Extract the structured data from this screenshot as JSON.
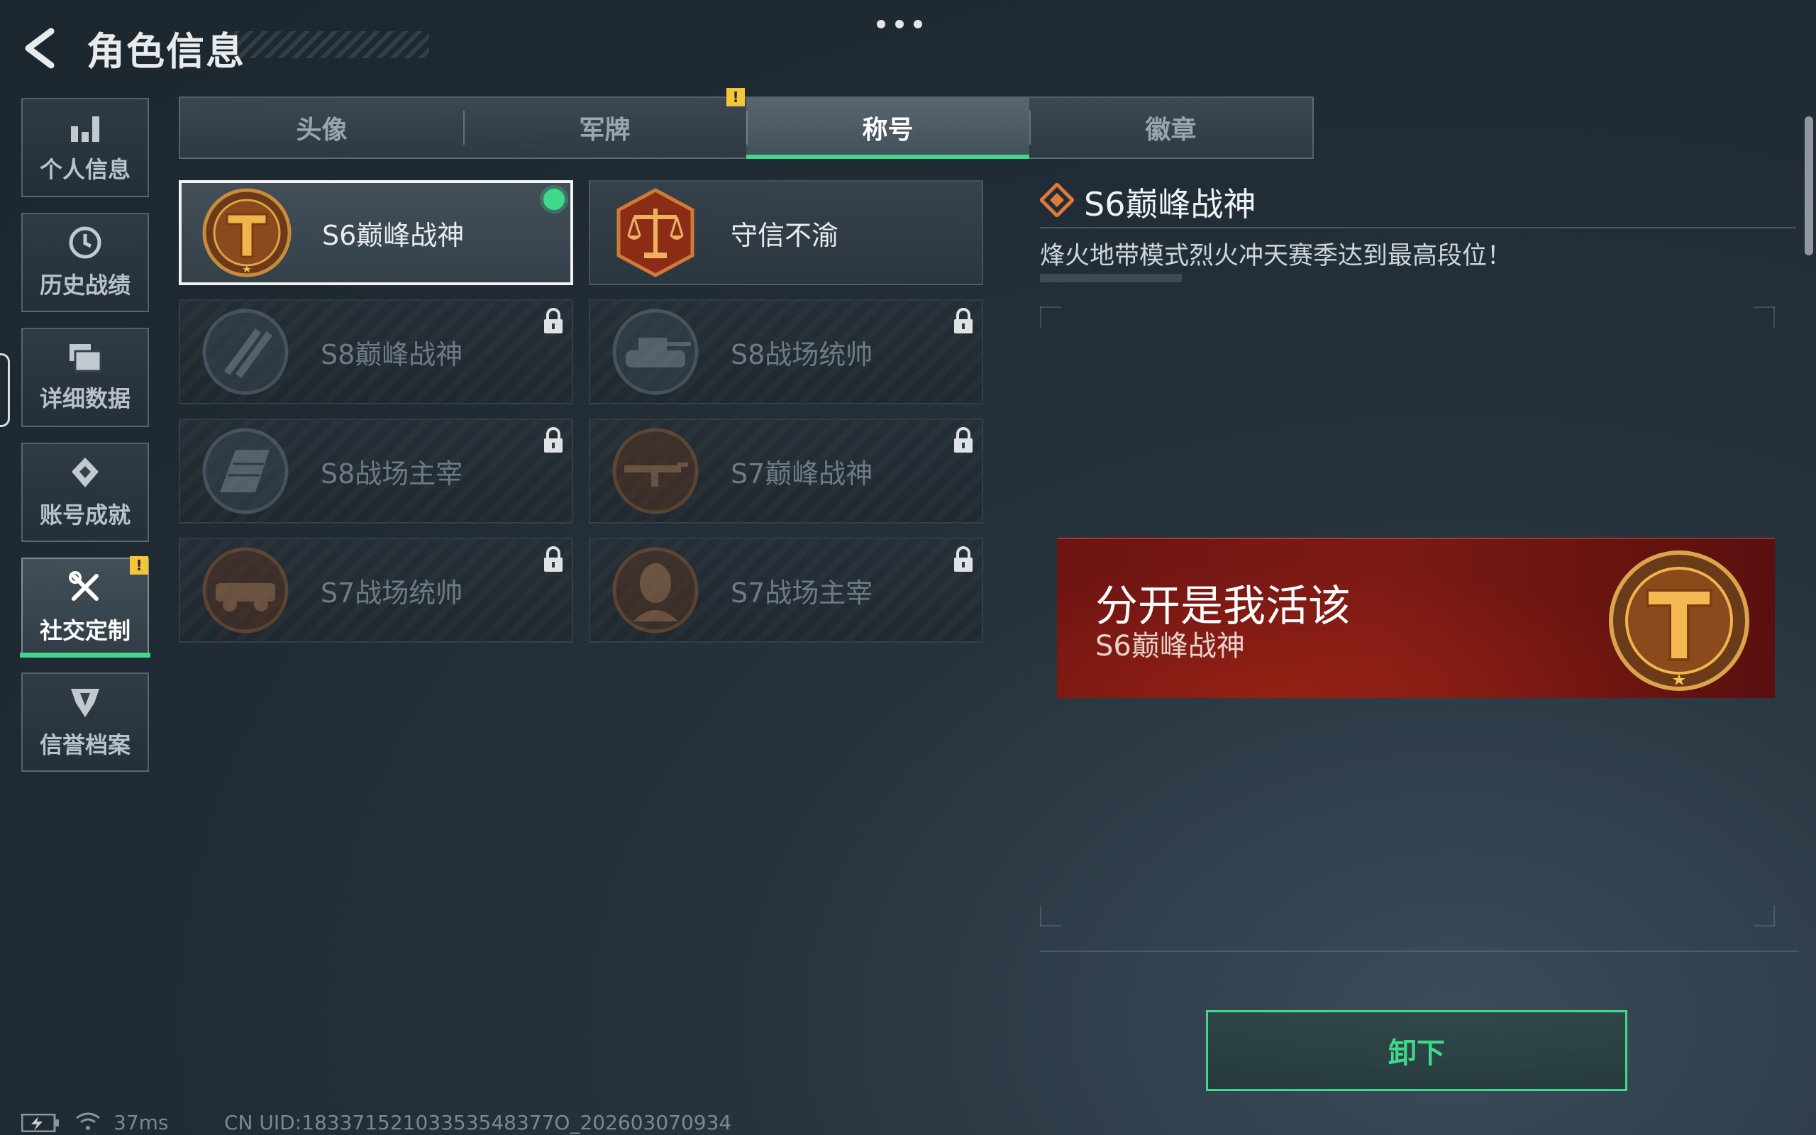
{
  "header": {
    "title": "角色信息"
  },
  "sidebar": {
    "items": [
      {
        "label": "个人信息",
        "icon": "bar-chart-icon"
      },
      {
        "label": "历史战绩",
        "icon": "history-clock-icon"
      },
      {
        "label": "详细数据",
        "icon": "folder-icon"
      },
      {
        "label": "账号成就",
        "icon": "achievement-icon"
      },
      {
        "label": "社交定制",
        "icon": "tools-icon",
        "active": true,
        "badge": "!"
      },
      {
        "label": "信誉档案",
        "icon": "credit-shield-icon"
      }
    ]
  },
  "tabs": [
    {
      "label": "头像"
    },
    {
      "label": "军牌",
      "badge": "!"
    },
    {
      "label": "称号",
      "active": true
    },
    {
      "label": "徽章"
    }
  ],
  "titles": [
    {
      "name": "S6巅峰战神",
      "selected": true,
      "locked": false,
      "icon": "golden-t-emblem-icon"
    },
    {
      "name": "守信不渝",
      "selected": false,
      "locked": false,
      "icon": "scales-emblem-icon"
    },
    {
      "name": "S8巅峰战神",
      "selected": false,
      "locked": true,
      "icon": "slash-emblem-icon"
    },
    {
      "name": "S8战场统帅",
      "selected": false,
      "locked": true,
      "icon": "tank-emblem-icon"
    },
    {
      "name": "S8战场主宰",
      "selected": false,
      "locked": true,
      "icon": "building-emblem-icon"
    },
    {
      "name": "S7巅峰战神",
      "selected": false,
      "locked": true,
      "icon": "rifle-emblem-icon"
    },
    {
      "name": "S7战场统帅",
      "selected": false,
      "locked": true,
      "icon": "vehicle-emblem-icon"
    },
    {
      "name": "S7战场主宰",
      "selected": false,
      "locked": true,
      "icon": "soldier-emblem-icon"
    }
  ],
  "detail": {
    "title": "S6巅峰战神",
    "description": "烽火地带模式烈火冲天赛季达到最高段位！",
    "preview": {
      "player_name": "分开是我活该",
      "title": "S6巅峰战神"
    }
  },
  "actions": {
    "unload_label": "卸下"
  },
  "status": {
    "ping": "37ms",
    "uid": "CN UID:18337152103353548377O_202603070934"
  },
  "colors": {
    "accent": "#3fd98c",
    "warning": "#f2c53a",
    "banner": "#7c1a16"
  }
}
